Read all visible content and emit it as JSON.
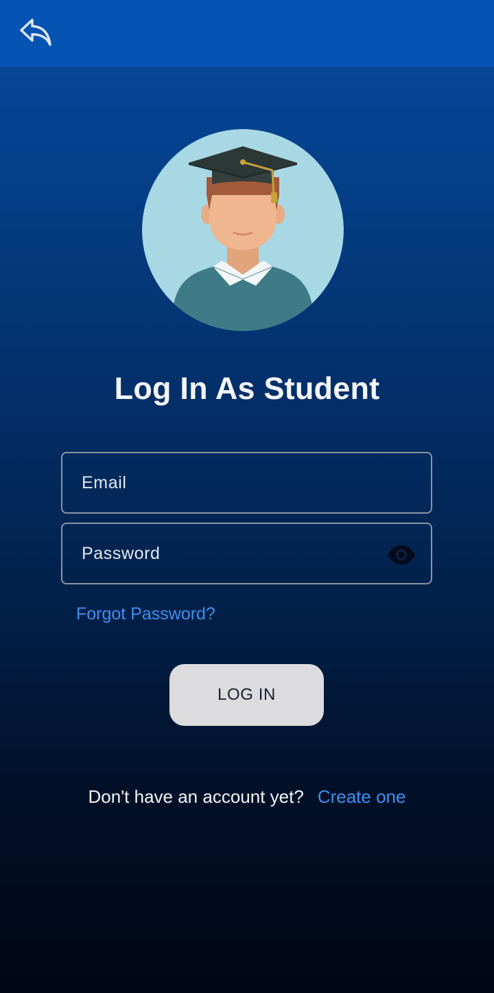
{
  "header": {
    "back_icon": "reply-arrow-icon"
  },
  "avatar": {
    "icon": "student-graduate-avatar",
    "background_color": "#a8d8e4"
  },
  "title": "Log In As Student",
  "form": {
    "email_placeholder": "Email",
    "password_placeholder": "Password",
    "password_toggle_icon": "eye-icon",
    "forgot_password": "Forgot Password?",
    "login_button": "LOG IN"
  },
  "signup": {
    "prompt": "Don't have an account yet?",
    "link": "Create one"
  },
  "colors": {
    "header_bar": "#0553b2",
    "link": "#3f8ff2",
    "button_bg": "#dcdcde"
  }
}
